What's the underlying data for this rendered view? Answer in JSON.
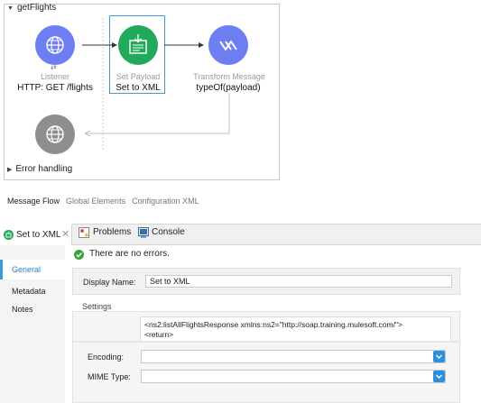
{
  "flow": {
    "name": "getFlights",
    "error_handling": "Error handling",
    "nodes": {
      "listener": {
        "label": "Listener",
        "value": "HTTP: GET /flights"
      },
      "set_payload": {
        "label": "Set Payload",
        "value": "Set to XML"
      },
      "transform": {
        "label": "Transform Message",
        "value": "typeOf(payload)"
      }
    }
  },
  "editor_tabs": [
    "Message Flow",
    "Global Elements",
    "Configuration XML"
  ],
  "view_tabs": {
    "active": "Set to XML",
    "problems": "Problems",
    "console": "Console"
  },
  "sidebar": [
    "General",
    "Metadata",
    "Notes"
  ],
  "status": {
    "message": "There are no errors."
  },
  "general": {
    "display_name_label": "Display Name:",
    "display_name_value": "Set to XML",
    "settings_label": "Settings",
    "value_line1": "<ns2:listAllFlightsResponse xmlns:ns2=\"http://soap.training.mulesoft.com/\">",
    "value_line2": "<return>",
    "encoding_label": "Encoding:",
    "encoding_value": "",
    "mime_label": "MIME Type:",
    "mime_value": ""
  },
  "colors": {
    "listener": "#6d7ef2",
    "set_payload": "#23a95b",
    "transform": "#6d7ef2",
    "error_source": "#8e8e8e",
    "selection": "#3b9bd6",
    "ok_green": "#37a63a",
    "dropdown": "#2b8fde"
  },
  "icons": [
    "globe-icon",
    "set-payload-icon",
    "transform-icon",
    "close-icon",
    "problems-icon",
    "console-icon",
    "check-icon",
    "chevron-down-icon"
  ]
}
